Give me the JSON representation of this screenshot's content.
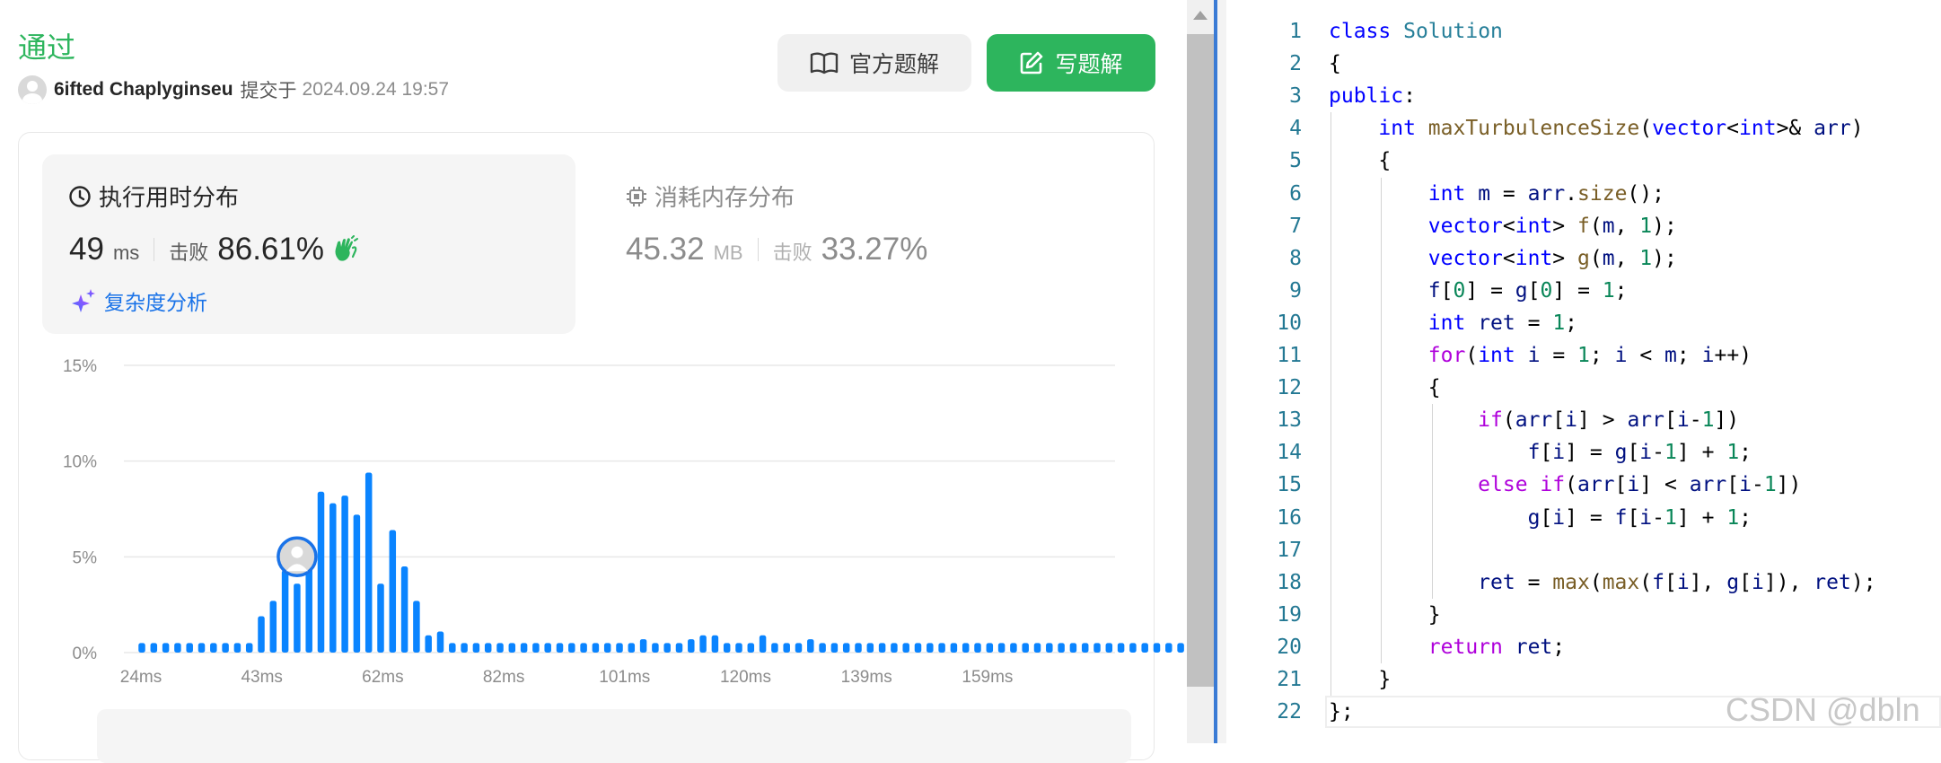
{
  "submission": {
    "status": "通过",
    "username": "6ifted Chaplyginseu",
    "submitted_label": "提交于",
    "submitted_time": "2024.09.24 19:57"
  },
  "buttons": {
    "official_solution": "官方题解",
    "write_solution": "写题解"
  },
  "runtime": {
    "title": "执行用时分布",
    "value": "49",
    "unit": "ms",
    "beat_label": "击败",
    "beat_percent": "86.61%",
    "complexity_label": "复杂度分析"
  },
  "memory": {
    "title": "消耗内存分布",
    "value": "45.32",
    "unit": "MB",
    "beat_label": "击败",
    "beat_percent": "33.27%"
  },
  "colors": {
    "accent_green": "#2db55d",
    "bar_blue": "#0a84ff",
    "link_blue": "#1a73e8"
  },
  "chart_data": {
    "type": "bar",
    "x_tick_labels": [
      "24ms",
      "43ms",
      "62ms",
      "82ms",
      "101ms",
      "120ms",
      "139ms",
      "159ms"
    ],
    "y_tick_labels": [
      "0%",
      "5%",
      "10%",
      "15%"
    ],
    "ylim": [
      0,
      15
    ],
    "grid": true,
    "highlight_index": 13,
    "values": [
      0.5,
      0.5,
      0.5,
      0.5,
      0.5,
      0.5,
      0.5,
      0.5,
      0.5,
      0.5,
      1.9,
      2.7,
      4.3,
      3.6,
      4.5,
      8.4,
      7.8,
      8.2,
      7.2,
      9.4,
      3.6,
      6.4,
      4.5,
      2.7,
      0.9,
      1.1,
      0.5,
      0.5,
      0.5,
      0.5,
      0.5,
      0.5,
      0.5,
      0.5,
      0.5,
      0.5,
      0.5,
      0.5,
      0.5,
      0.5,
      0.5,
      0.5,
      0.7,
      0.5,
      0.5,
      0.5,
      0.7,
      0.9,
      0.9,
      0.5,
      0.5,
      0.5,
      0.9,
      0.5,
      0.5,
      0.5,
      0.7,
      0.5,
      0.5,
      0.5,
      0.5,
      0.5,
      0.5,
      0.5,
      0.5,
      0.5,
      0.5,
      0.5,
      0.5,
      0.5,
      0.5,
      0.5,
      0.5,
      0.5,
      0.5,
      0.5,
      0.5,
      0.5,
      0.5,
      0.5,
      0.5,
      0.5,
      0.5,
      0.5,
      0.5,
      0.5,
      0.5,
      0.5,
      0.5,
      0.5,
      0.5,
      0.5,
      0.5
    ]
  },
  "editor": {
    "lines": [
      {
        "n": "1",
        "code": "class Solution"
      },
      {
        "n": "2",
        "code": "{"
      },
      {
        "n": "3",
        "code": "public:"
      },
      {
        "n": "4",
        "code": "    int maxTurbulenceSize(vector<int>& arr)"
      },
      {
        "n": "5",
        "code": "    {"
      },
      {
        "n": "6",
        "code": "        int m = arr.size();"
      },
      {
        "n": "7",
        "code": "        vector<int> f(m, 1);"
      },
      {
        "n": "8",
        "code": "        vector<int> g(m, 1);"
      },
      {
        "n": "9",
        "code": "        f[0] = g[0] = 1;"
      },
      {
        "n": "10",
        "code": "        int ret = 1;"
      },
      {
        "n": "11",
        "code": "        for(int i = 1; i < m; i++)"
      },
      {
        "n": "12",
        "code": "        {"
      },
      {
        "n": "13",
        "code": "            if(arr[i] > arr[i-1])"
      },
      {
        "n": "14",
        "code": "                f[i] = g[i-1] + 1;"
      },
      {
        "n": "15",
        "code": "            else if(arr[i] < arr[i-1])"
      },
      {
        "n": "16",
        "code": "                g[i] = f[i-1] + 1;"
      },
      {
        "n": "17",
        "code": ""
      },
      {
        "n": "18",
        "code": "            ret = max(max(f[i], g[i]), ret);"
      },
      {
        "n": "19",
        "code": "        }"
      },
      {
        "n": "20",
        "code": "        return ret;"
      },
      {
        "n": "21",
        "code": "    }"
      },
      {
        "n": "22",
        "code": "};"
      }
    ],
    "watermark": "CSDN @dbln"
  }
}
